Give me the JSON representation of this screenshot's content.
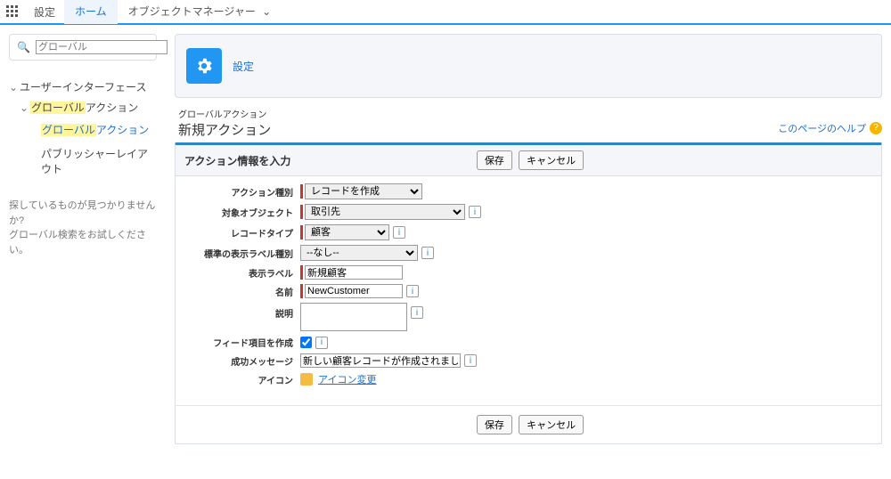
{
  "top": {
    "appLabel": "設定",
    "tabHome": "ホーム",
    "tabObjectManager": "オブジェクトマネージャー"
  },
  "sidebar": {
    "searchPlaceholder": "グローバル",
    "root": "ユーザーインターフェース",
    "item1a": "グローバル",
    "item1b": "アクション",
    "item2a": "グローバル",
    "item2b": "アクション",
    "item3": "パブリッシャーレイアウト",
    "hint1": "探しているものが見つかりませんか?",
    "hint2": "グローバル検索をお試しください。"
  },
  "header": {
    "bannerTitle": "設定",
    "breadcrumb": "グローバルアクション",
    "pageTitle": "新規アクション",
    "helpText": "このページのヘルプ"
  },
  "form": {
    "sectionTitle": "アクション情報を入力",
    "saveBtn": "保存",
    "cancelBtn": "キャンセル",
    "labels": {
      "actionType": "アクション種別",
      "targetObject": "対象オブジェクト",
      "recordType": "レコードタイプ",
      "standardLabelType": "標準の表示ラベル種別",
      "displayLabel": "表示ラベル",
      "name": "名前",
      "description": "説明",
      "createFeedItem": "フィード項目を作成",
      "successMessage": "成功メッセージ",
      "icon": "アイコン"
    },
    "values": {
      "actionType": "レコードを作成",
      "targetObject": "取引先",
      "recordType": "顧客",
      "standardLabelType": "--なし--",
      "displayLabel": "新規顧客",
      "name": "NewCustomer",
      "description": "",
      "successMessage": "新しい顧客レコードが作成されました。",
      "iconChangeLink": "アイコン変更"
    }
  }
}
